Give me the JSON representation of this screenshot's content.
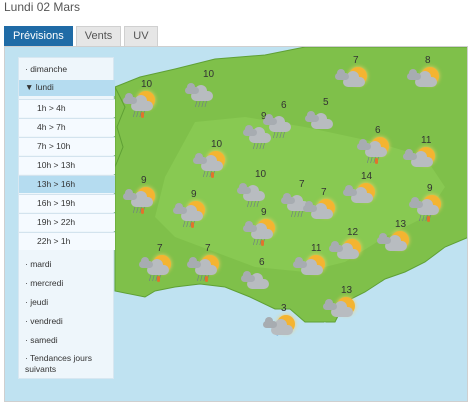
{
  "header": {
    "title": "Lundi 02 Mars"
  },
  "tabs": [
    {
      "label": "Prévisions",
      "active": true
    },
    {
      "label": "Vents",
      "active": false
    },
    {
      "label": "UV",
      "active": false
    }
  ],
  "sidebar": {
    "days_top": [
      {
        "label": "dimanche"
      }
    ],
    "current_day": {
      "label": "lundi"
    },
    "slots": [
      {
        "label": "1h > 4h"
      },
      {
        "label": "4h > 7h"
      },
      {
        "label": "7h > 10h"
      },
      {
        "label": "10h > 13h"
      },
      {
        "label": "13h > 16h",
        "selected": true
      },
      {
        "label": "16h > 19h"
      },
      {
        "label": "19h > 22h"
      },
      {
        "label": "22h > 1h"
      }
    ],
    "days_bottom": [
      {
        "label": "mardi"
      },
      {
        "label": "mercredi"
      },
      {
        "label": "jeudi"
      },
      {
        "label": "vendredi"
      },
      {
        "label": "samedi"
      },
      {
        "label": "Tendances jours suivants"
      }
    ]
  },
  "colors": {
    "land": "#7fc04a",
    "sea": "#bfe2f1",
    "tab_active": "#1f6ba6"
  },
  "weather": [
    {
      "temp": "10",
      "icon": "rain-sun-icon"
    },
    {
      "temp": "10",
      "icon": "rain-cloud-icon"
    },
    {
      "temp": "7",
      "icon": "sun-cloud-icon"
    },
    {
      "temp": "8",
      "icon": "sun-cloud-icon"
    },
    {
      "temp": "5",
      "icon": "cloud-icon"
    },
    {
      "temp": "10",
      "icon": "rain-sun-icon"
    },
    {
      "temp": "9",
      "icon": "rain-cloud-icon"
    },
    {
      "temp": "6",
      "icon": "rain-cloud-icon"
    },
    {
      "temp": "6",
      "icon": "rain-sun-icon"
    },
    {
      "temp": "11",
      "icon": "sun-cloud-icon"
    },
    {
      "temp": "9",
      "icon": "rain-sun-icon"
    },
    {
      "temp": "9",
      "icon": "rain-sun-icon"
    },
    {
      "temp": "10",
      "icon": "rain-cloud-icon"
    },
    {
      "temp": "7",
      "icon": "rain-cloud-icon"
    },
    {
      "temp": "7",
      "icon": "sun-cloud-icon"
    },
    {
      "temp": "14",
      "icon": "sun-cloud-icon"
    },
    {
      "temp": "9",
      "icon": "rain-sun-icon"
    },
    {
      "temp": "9",
      "icon": "rain-sun-icon"
    },
    {
      "temp": "13",
      "icon": "sun-cloud-icon"
    },
    {
      "temp": "12",
      "icon": "sun-cloud-icon"
    },
    {
      "temp": "7",
      "icon": "rain-sun-icon"
    },
    {
      "temp": "7",
      "icon": "rain-sun-icon"
    },
    {
      "temp": "6",
      "icon": "cloud-icon"
    },
    {
      "temp": "11",
      "icon": "sun-cloud-icon"
    },
    {
      "temp": "13",
      "icon": "sun-cloud-icon"
    },
    {
      "temp": "3",
      "icon": "sun-cloud-icon"
    }
  ]
}
